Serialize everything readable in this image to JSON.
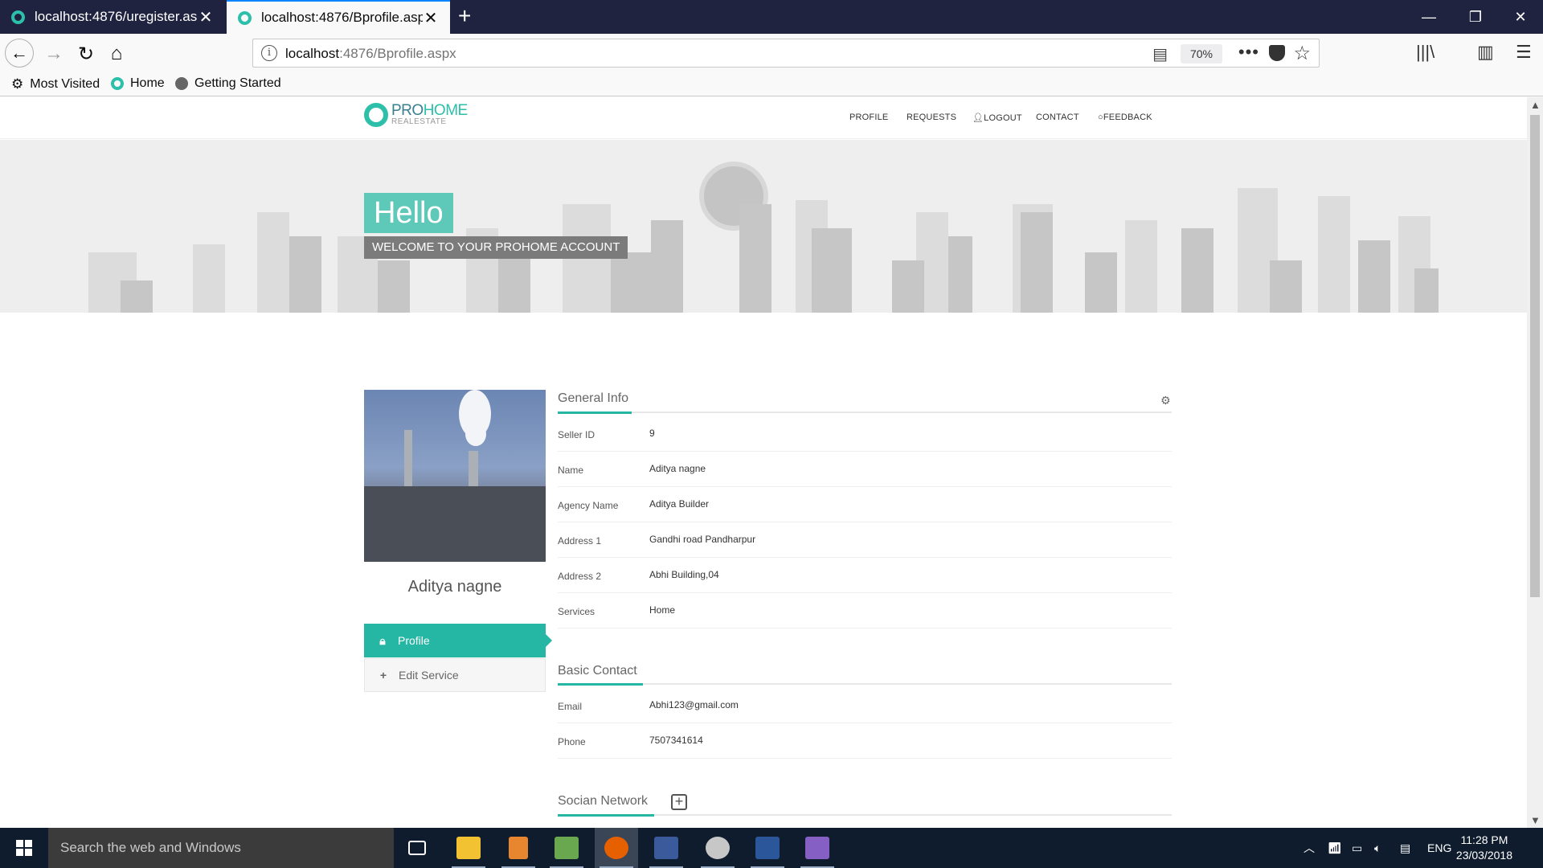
{
  "browser": {
    "tabs": [
      {
        "title": "localhost:4876/uregister.aspx",
        "active": false
      },
      {
        "title": "localhost:4876/Bprofile.aspx",
        "active": true
      }
    ],
    "url_host": "localhost",
    "url_rest": ":4876/Bprofile.aspx",
    "zoom": "70%",
    "bookmarks": [
      "Most Visited",
      "Home",
      "Getting Started"
    ]
  },
  "site": {
    "logo_main_a": "PRO",
    "logo_main_b": "HOME",
    "logo_sub": "REALESTATE",
    "menu": [
      "PROFILE",
      "REQUESTS",
      "LOGOUT",
      "CONTACT",
      "FEEDBACK"
    ],
    "hero_title": "Hello",
    "hero_subtitle": "WELCOME TO YOUR PROHOME ACCOUNT"
  },
  "profile": {
    "name": "Aditya nagne",
    "sidebar": [
      {
        "label": "Profile",
        "active": true
      },
      {
        "label": "Edit Service",
        "active": false
      }
    ]
  },
  "general_info": {
    "title": "General Info",
    "rows": [
      {
        "label": "Seller ID",
        "value": "9"
      },
      {
        "label": "Name",
        "value": "Aditya nagne"
      },
      {
        "label": "Agency Name",
        "value": "Aditya Builder"
      },
      {
        "label": "Address 1",
        "value": "Gandhi road Pandharpur"
      },
      {
        "label": "Address 2",
        "value": "Abhi Building,04"
      },
      {
        "label": "Services",
        "value": "Home"
      }
    ]
  },
  "basic_contact": {
    "title": "Basic Contact",
    "rows": [
      {
        "label": "Email",
        "value": "Abhi123@gmail.com"
      },
      {
        "label": "Phone",
        "value": "7507341614"
      }
    ]
  },
  "social": {
    "title": "Socian Network"
  },
  "taskbar": {
    "search_placeholder": "Search the web and Windows",
    "language": "ENG",
    "time": "11:28 PM",
    "date": "23/03/2018"
  },
  "colors": {
    "accent": "#26b6a4",
    "tabbar": "#202340",
    "taskbar": "#0f1c2e"
  }
}
